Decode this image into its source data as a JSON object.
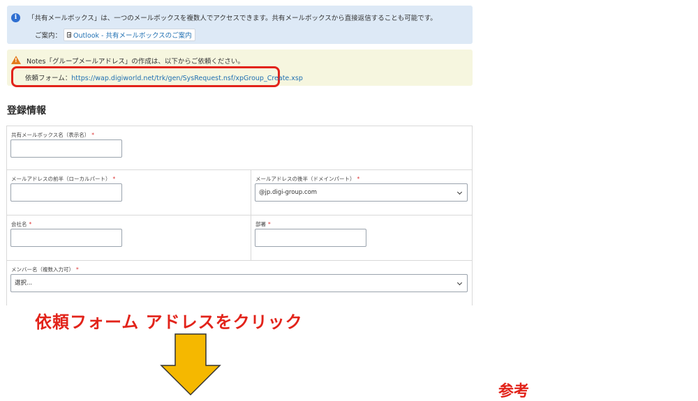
{
  "info": {
    "message": "「共有メールボックス」は、一つのメールボックスを複数人でアクセスできます。共有メールボックスから直接返信することも可能です。",
    "guide_prefix": "ご案内：",
    "guide_link": "Outlook - 共有メールボックスのご案内"
  },
  "warning": {
    "message": "Notes「グループメールアドレス」の作成は、以下からご依頼ください。",
    "form_label": "依頼フォーム：",
    "form_url": "https://wap.digiworld.net/trk/gen/SysRequest.nsf/xpGroup_Create.xsp"
  },
  "section_title": "登録情報",
  "form": {
    "display_name_label": "共有メールボックス名（表示名）",
    "local_part_label": "メールアドレスの前半（ローカルパート）",
    "domain_label": "メールアドレスの後半（ドメインパート）",
    "domain_value": "@jp.digi-group.com",
    "company_label": "会社名",
    "department_label": "部署",
    "members_label": "メンバー名（複数入力可）",
    "members_placeholder": "選択...",
    "required_mark": "*"
  },
  "annotation": {
    "instruction": "依頼フォーム アドレスをクリック",
    "reference": "参考"
  },
  "colors": {
    "info_bg": "#dde9f6",
    "warning_bg": "#f6f6df",
    "highlight": "#e2231a",
    "arrow": "#f5b800",
    "link": "#1f6fb2"
  }
}
